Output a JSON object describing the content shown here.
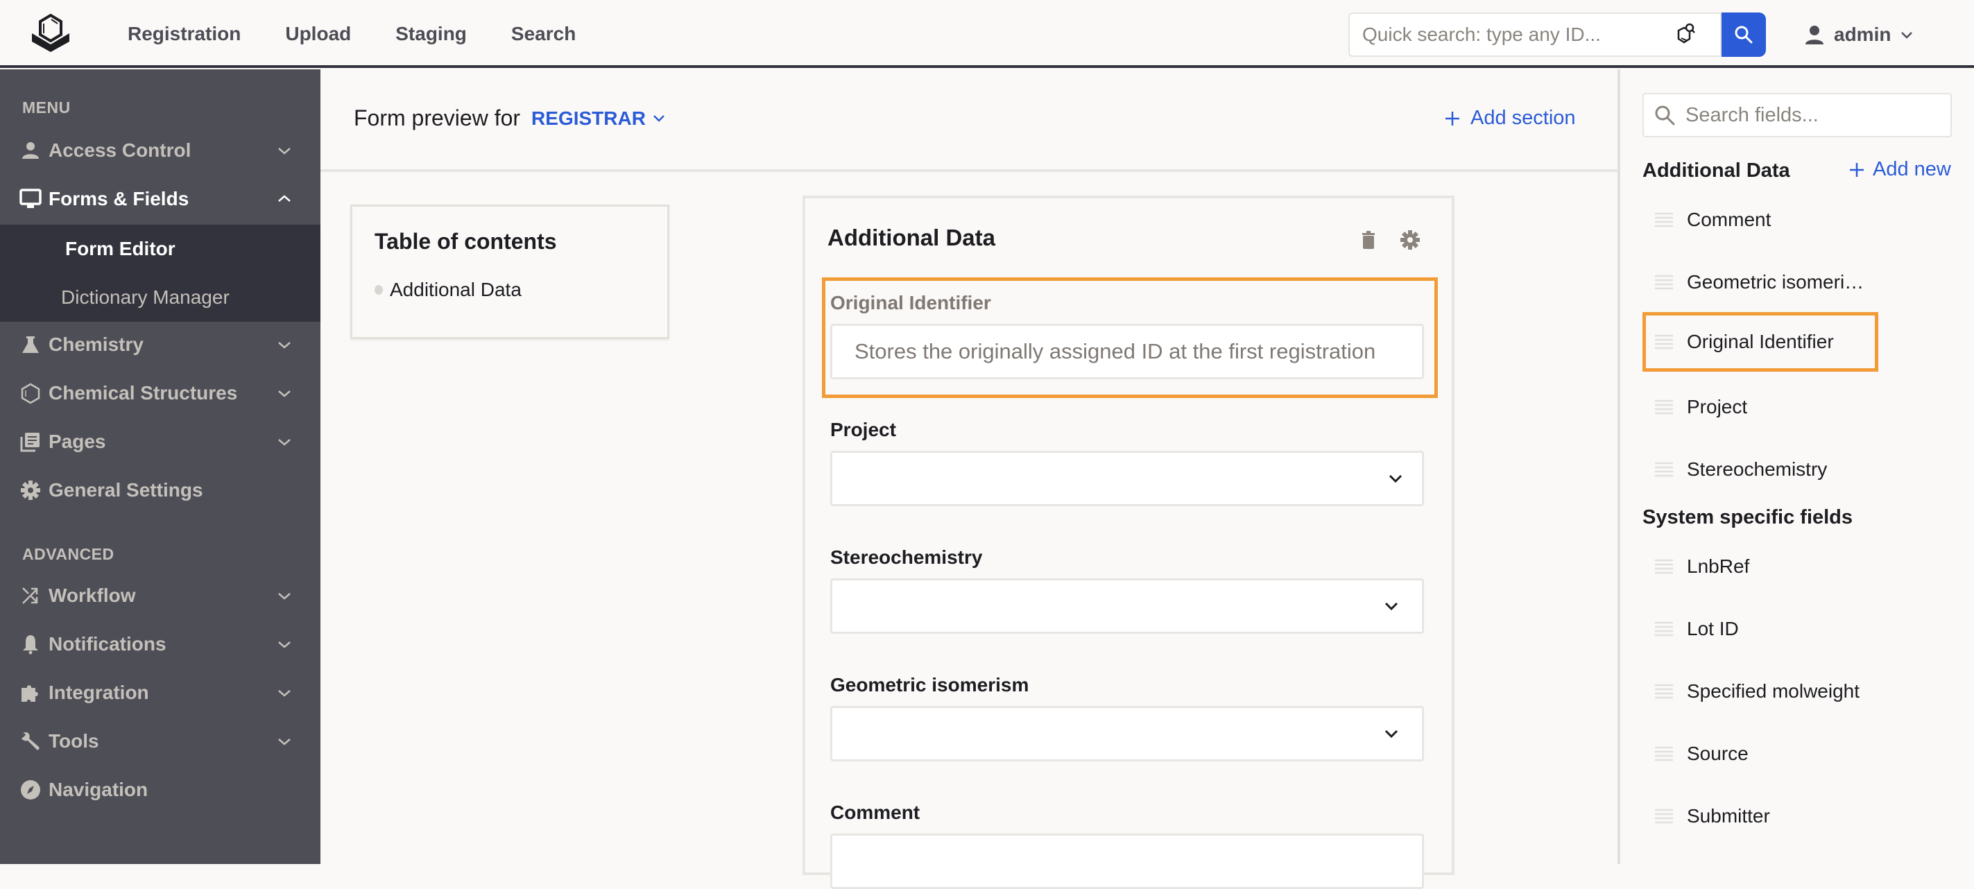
{
  "topbar": {
    "nav": [
      "Registration",
      "Upload",
      "Staging",
      "Search"
    ],
    "quick_search_placeholder": "Quick search: type any ID...",
    "user": "admin"
  },
  "sidebar": {
    "menu_heading": "MENU",
    "advanced_heading": "ADVANCED",
    "items": [
      {
        "label": "Access Control",
        "icon": "user-icon",
        "expandable": true
      },
      {
        "label": "Forms & Fields",
        "icon": "monitor-icon",
        "expandable": true,
        "expanded": true
      },
      {
        "label": "Chemistry",
        "icon": "flask-icon",
        "expandable": true
      },
      {
        "label": "Chemical Structures",
        "icon": "hexagon-icon",
        "expandable": true
      },
      {
        "label": "Pages",
        "icon": "pages-icon",
        "expandable": true
      },
      {
        "label": "General Settings",
        "icon": "gear-icon",
        "expandable": false
      }
    ],
    "sub_items": [
      {
        "label": "Form Editor",
        "active": true
      },
      {
        "label": "Dictionary Manager",
        "active": false
      }
    ],
    "advanced_items": [
      {
        "label": "Workflow",
        "icon": "shuffle-icon",
        "expandable": true
      },
      {
        "label": "Notifications",
        "icon": "bell-icon",
        "expandable": true
      },
      {
        "label": "Integration",
        "icon": "puzzle-icon",
        "expandable": true
      },
      {
        "label": "Tools",
        "icon": "wrench-icon",
        "expandable": true
      },
      {
        "label": "Navigation",
        "icon": "compass-icon",
        "expandable": false
      }
    ]
  },
  "main": {
    "preview_label": "Form preview for",
    "role": "REGISTRAR",
    "add_section": "Add section",
    "toc": {
      "title": "Table of contents",
      "items": [
        "Additional Data"
      ]
    },
    "section": {
      "title": "Additional Data",
      "fields": [
        {
          "label": "Original Identifier",
          "type": "text",
          "placeholder": "Stores the originally assigned ID at the first registration",
          "highlighted": true
        },
        {
          "label": "Project",
          "type": "select",
          "value": ""
        },
        {
          "label": "Stereochemistry",
          "type": "select",
          "value": ""
        },
        {
          "label": "Geometric isomerism",
          "type": "select",
          "value": ""
        },
        {
          "label": "Comment",
          "type": "text",
          "value": ""
        }
      ]
    }
  },
  "right_panel": {
    "search_placeholder": "Search fields...",
    "groups": [
      {
        "title": "Additional Data",
        "add_label": "Add new",
        "items": [
          "Comment",
          "Geometric isomeri…",
          "Original Identifier",
          "Project",
          "Stereochemistry"
        ],
        "highlighted": "Original Identifier"
      },
      {
        "title": "System specific fields",
        "items": [
          "LnbRef",
          "Lot ID",
          "Specified molweight",
          "Source",
          "Submitter"
        ]
      }
    ]
  },
  "colors": {
    "accent": "#2b5bd7",
    "highlight": "#f29c38",
    "sidebar_bg": "#4e4e57",
    "sidebar_active_bg": "#33333d"
  }
}
